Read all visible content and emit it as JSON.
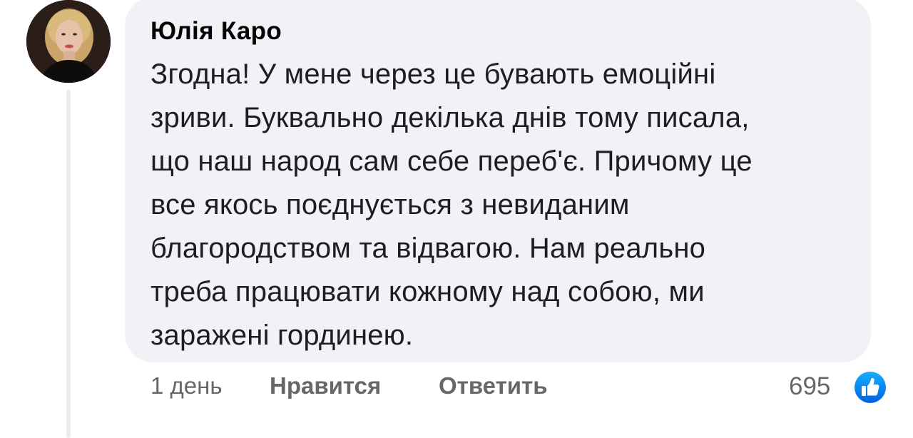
{
  "comment": {
    "author": "Юлія Каро",
    "text": "Згодна! У мене через це бувають емоційні\nзриви. Буквально декілька днів тому писала,\nщо наш народ сам себе переб'є. Причому це\nвсе якось поєднується з невиданим\nблагородством та відвагою. Нам реально\nтреба працювати кожному над собою, ми\nзаражені гординею.",
    "avatar_icon": "user-avatar-photo"
  },
  "actions": {
    "time": "1 день",
    "like_label": "Нравится",
    "reply_label": "Ответить"
  },
  "reactions": {
    "count": "695",
    "icon": "thumbs-up-icon",
    "color": "#1877f2"
  },
  "colors": {
    "bubble_bg": "#f0f2f5",
    "text": "#1c1e21",
    "secondary_text": "#65676b"
  }
}
